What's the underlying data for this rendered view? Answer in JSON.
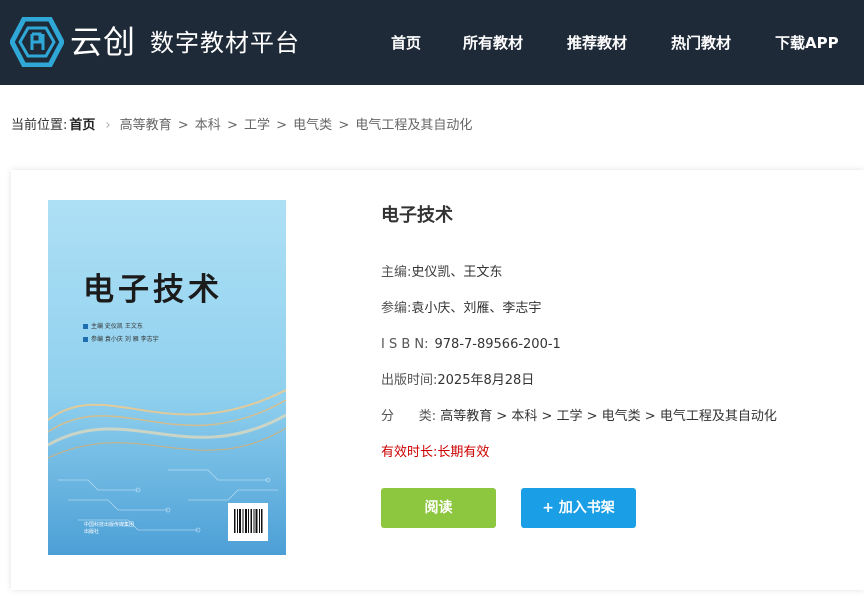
{
  "header": {
    "brand": "云创",
    "subtitle": "数字教材平台",
    "nav": [
      "首页",
      "所有教材",
      "推荐教材",
      "热门教材",
      "下载APP"
    ],
    "bg_color": "#1e2a38",
    "logo_color": "#2fa8d8"
  },
  "breadcrumb": {
    "label": "当前位置:",
    "home": "首页",
    "path": [
      "高等教育",
      "本科",
      "工学",
      "电气类",
      "电气工程及其自动化"
    ]
  },
  "book": {
    "title": "电子技术",
    "cover": {
      "title": "电子技术",
      "line1": "主编   史仪凯   王文东",
      "line2": "参编   袁小庆   刘   雁   李志宇",
      "publisher_line1": "中国科技出版传媒集团",
      "publisher_line2": "出版社"
    },
    "meta": [
      {
        "label": "主编:",
        "value": "史仪凯、王文东"
      },
      {
        "label": "参编:",
        "value": "袁小庆、刘雁、李志宇"
      },
      {
        "label": "I S B N:",
        "value": "978-7-89566-200-1"
      },
      {
        "label": "出版时间:",
        "value": "2025年8月28日"
      },
      {
        "label": "分      类:",
        "value": "高等教育 > 本科 > 工学 > 电气类 > 电气工程及其自动化"
      }
    ],
    "validity": {
      "label": "有效时长:",
      "value": "长期有效",
      "color": "#cc0000"
    }
  },
  "buttons": {
    "read": "阅读",
    "add_shelf": "+ 加入书架",
    "read_color": "#8dc63f",
    "shelf_color": "#1a9ee5"
  }
}
